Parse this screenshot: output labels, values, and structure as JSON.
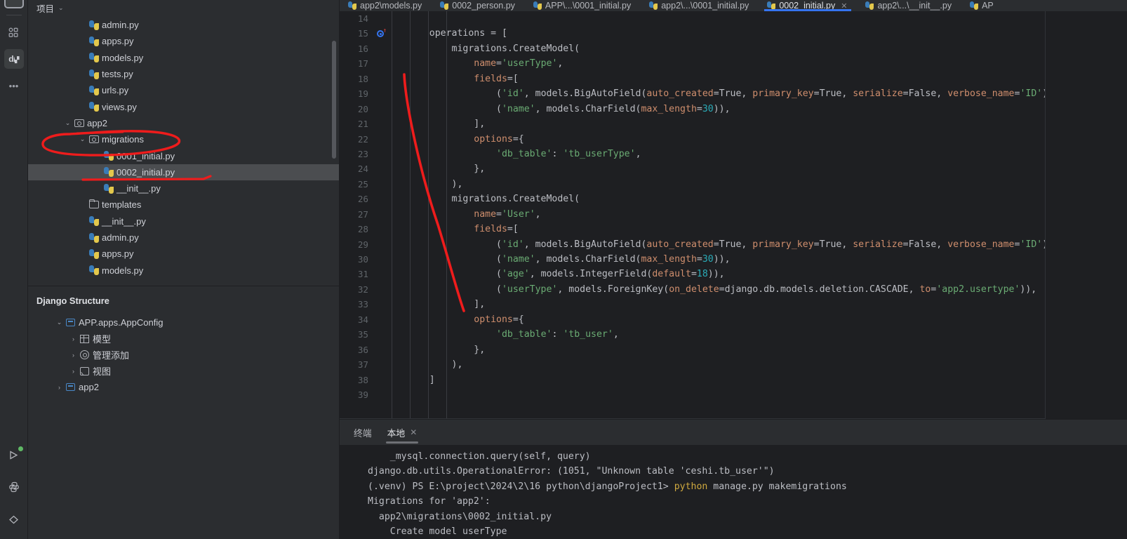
{
  "activitybar": {
    "items": [
      {
        "name": "project-tool-window-icon",
        "glyph": "▭"
      },
      {
        "name": "structure-tool-window-icon",
        "glyph": "▫▫"
      },
      {
        "name": "database-tool-window-icon",
        "glyph": "di"
      },
      {
        "name": "more-tool-windows-icon",
        "glyph": "•••"
      }
    ],
    "bottom_items": [
      {
        "name": "run-icon",
        "glyph": "▷"
      },
      {
        "name": "python-console-icon",
        "glyph": "py"
      },
      {
        "name": "problems-icon",
        "glyph": "◇"
      }
    ]
  },
  "project_panel": {
    "title": "项目",
    "tree": [
      {
        "indent": 3,
        "twisty": "",
        "icon": "py",
        "label": "admin.py"
      },
      {
        "indent": 3,
        "twisty": "",
        "icon": "py",
        "label": "apps.py"
      },
      {
        "indent": 3,
        "twisty": "",
        "icon": "py",
        "label": "models.py"
      },
      {
        "indent": 3,
        "twisty": "",
        "icon": "py",
        "label": "tests.py"
      },
      {
        "indent": 3,
        "twisty": "",
        "icon": "py",
        "label": "urls.py"
      },
      {
        "indent": 3,
        "twisty": "",
        "icon": "py",
        "label": "views.py"
      },
      {
        "indent": 2,
        "twisty": "⌄",
        "icon": "folder-mod",
        "label": "app2"
      },
      {
        "indent": 3,
        "twisty": "⌄",
        "icon": "folder-mod",
        "label": "migrations"
      },
      {
        "indent": 4,
        "twisty": "",
        "icon": "py",
        "label": "0001_initial.py"
      },
      {
        "indent": 4,
        "twisty": "",
        "icon": "py",
        "label": "0002_initial.py",
        "selected": true
      },
      {
        "indent": 4,
        "twisty": "",
        "icon": "py",
        "label": "__init__.py"
      },
      {
        "indent": 3,
        "twisty": "",
        "icon": "folder",
        "label": "templates"
      },
      {
        "indent": 3,
        "twisty": "",
        "icon": "py",
        "label": "__init__.py"
      },
      {
        "indent": 3,
        "twisty": "",
        "icon": "py",
        "label": "admin.py"
      },
      {
        "indent": 3,
        "twisty": "",
        "icon": "py",
        "label": "apps.py"
      },
      {
        "indent": 3,
        "twisty": "",
        "icon": "py",
        "label": "models.py"
      }
    ]
  },
  "structure_panel": {
    "title": "Django Structure",
    "rows": [
      {
        "indent": 1,
        "twisty": "⌄",
        "icon": "square",
        "label": "APP.apps.AppConfig"
      },
      {
        "indent": 2,
        "twisty": "›",
        "icon": "grid",
        "label": "模型"
      },
      {
        "indent": 2,
        "twisty": "›",
        "icon": "gear",
        "label": "管理添加"
      },
      {
        "indent": 2,
        "twisty": "›",
        "icon": "image",
        "label": "视图"
      },
      {
        "indent": 1,
        "twisty": "›",
        "icon": "square",
        "label": "app2"
      }
    ]
  },
  "editor": {
    "tabs": [
      {
        "label": "app2\\models.py",
        "active": false,
        "closable": false
      },
      {
        "label": "0002_person.py",
        "active": false,
        "closable": false
      },
      {
        "label": "APP\\...\\0001_initial.py",
        "active": false,
        "closable": false
      },
      {
        "label": "app2\\...\\0001_initial.py",
        "active": false,
        "closable": false
      },
      {
        "label": "0002_initial.py",
        "active": true,
        "closable": true,
        "close_glyph": "✕"
      },
      {
        "label": "app2\\...\\__init__.py",
        "active": false,
        "closable": false
      },
      {
        "label": "AP",
        "active": false,
        "closable": false
      }
    ],
    "first_line_number": 14,
    "lines": [
      {
        "num": 14,
        "marker": false,
        "tokens": []
      },
      {
        "num": 15,
        "marker": true,
        "tokens": [
          {
            "t": "    ",
            "c": "t-def"
          },
          {
            "t": "operations",
            "c": "t-def"
          },
          {
            "t": " = [",
            "c": "t-def"
          }
        ]
      },
      {
        "num": 16,
        "marker": false,
        "tokens": [
          {
            "t": "        migrations.CreateModel(",
            "c": "t-def"
          }
        ]
      },
      {
        "num": 17,
        "marker": false,
        "tokens": [
          {
            "t": "            ",
            "c": "t-def"
          },
          {
            "t": "name",
            "c": "t-kw"
          },
          {
            "t": "=",
            "c": "t-def"
          },
          {
            "t": "'userType'",
            "c": "t-str"
          },
          {
            "t": ",",
            "c": "t-def"
          }
        ]
      },
      {
        "num": 18,
        "marker": false,
        "tokens": [
          {
            "t": "            ",
            "c": "t-def"
          },
          {
            "t": "fields",
            "c": "t-kw"
          },
          {
            "t": "=[",
            "c": "t-def"
          }
        ]
      },
      {
        "num": 19,
        "marker": false,
        "tokens": [
          {
            "t": "                (",
            "c": "t-def"
          },
          {
            "t": "'id'",
            "c": "t-str"
          },
          {
            "t": ", models.BigAutoField(",
            "c": "t-def"
          },
          {
            "t": "auto_created",
            "c": "t-kw"
          },
          {
            "t": "=True, ",
            "c": "t-def"
          },
          {
            "t": "primary_key",
            "c": "t-kw"
          },
          {
            "t": "=True, ",
            "c": "t-def"
          },
          {
            "t": "serialize",
            "c": "t-kw"
          },
          {
            "t": "=False, ",
            "c": "t-def"
          },
          {
            "t": "verbose_name",
            "c": "t-kw"
          },
          {
            "t": "=",
            "c": "t-def"
          },
          {
            "t": "'ID'",
            "c": "t-str"
          },
          {
            "t": ")),",
            "c": "t-def"
          }
        ]
      },
      {
        "num": 20,
        "marker": false,
        "tokens": [
          {
            "t": "                (",
            "c": "t-def"
          },
          {
            "t": "'name'",
            "c": "t-str"
          },
          {
            "t": ", models.CharField(",
            "c": "t-def"
          },
          {
            "t": "max_length",
            "c": "t-kw"
          },
          {
            "t": "=",
            "c": "t-def"
          },
          {
            "t": "30",
            "c": "t-num"
          },
          {
            "t": ")),",
            "c": "t-def"
          }
        ]
      },
      {
        "num": 21,
        "marker": false,
        "tokens": [
          {
            "t": "            ],",
            "c": "t-def"
          }
        ]
      },
      {
        "num": 22,
        "marker": false,
        "tokens": [
          {
            "t": "            ",
            "c": "t-def"
          },
          {
            "t": "options",
            "c": "t-kw"
          },
          {
            "t": "={",
            "c": "t-def"
          }
        ]
      },
      {
        "num": 23,
        "marker": false,
        "tokens": [
          {
            "t": "                ",
            "c": "t-def"
          },
          {
            "t": "'db_table'",
            "c": "t-str"
          },
          {
            "t": ": ",
            "c": "t-def"
          },
          {
            "t": "'tb_userType'",
            "c": "t-str"
          },
          {
            "t": ",",
            "c": "t-def"
          }
        ]
      },
      {
        "num": 24,
        "marker": false,
        "tokens": [
          {
            "t": "            },",
            "c": "t-def"
          }
        ]
      },
      {
        "num": 25,
        "marker": false,
        "tokens": [
          {
            "t": "        ),",
            "c": "t-def"
          }
        ]
      },
      {
        "num": 26,
        "marker": false,
        "tokens": [
          {
            "t": "        migrations.CreateModel(",
            "c": "t-def"
          }
        ]
      },
      {
        "num": 27,
        "marker": false,
        "tokens": [
          {
            "t": "            ",
            "c": "t-def"
          },
          {
            "t": "name",
            "c": "t-kw"
          },
          {
            "t": "=",
            "c": "t-def"
          },
          {
            "t": "'User'",
            "c": "t-str"
          },
          {
            "t": ",",
            "c": "t-def"
          }
        ]
      },
      {
        "num": 28,
        "marker": false,
        "tokens": [
          {
            "t": "            ",
            "c": "t-def"
          },
          {
            "t": "fields",
            "c": "t-kw"
          },
          {
            "t": "=[",
            "c": "t-def"
          }
        ]
      },
      {
        "num": 29,
        "marker": false,
        "tokens": [
          {
            "t": "                (",
            "c": "t-def"
          },
          {
            "t": "'id'",
            "c": "t-str"
          },
          {
            "t": ", models.BigAutoField(",
            "c": "t-def"
          },
          {
            "t": "auto_created",
            "c": "t-kw"
          },
          {
            "t": "=True, ",
            "c": "t-def"
          },
          {
            "t": "primary_key",
            "c": "t-kw"
          },
          {
            "t": "=True, ",
            "c": "t-def"
          },
          {
            "t": "serialize",
            "c": "t-kw"
          },
          {
            "t": "=False, ",
            "c": "t-def"
          },
          {
            "t": "verbose_name",
            "c": "t-kw"
          },
          {
            "t": "=",
            "c": "t-def"
          },
          {
            "t": "'ID'",
            "c": "t-str"
          },
          {
            "t": ")),",
            "c": "t-def"
          }
        ]
      },
      {
        "num": 30,
        "marker": false,
        "tokens": [
          {
            "t": "                (",
            "c": "t-def"
          },
          {
            "t": "'name'",
            "c": "t-str"
          },
          {
            "t": ", models.CharField(",
            "c": "t-def"
          },
          {
            "t": "max_length",
            "c": "t-kw"
          },
          {
            "t": "=",
            "c": "t-def"
          },
          {
            "t": "30",
            "c": "t-num"
          },
          {
            "t": ")),",
            "c": "t-def"
          }
        ]
      },
      {
        "num": 31,
        "marker": false,
        "tokens": [
          {
            "t": "                (",
            "c": "t-def"
          },
          {
            "t": "'age'",
            "c": "t-str"
          },
          {
            "t": ", models.IntegerField(",
            "c": "t-def"
          },
          {
            "t": "default",
            "c": "t-kw"
          },
          {
            "t": "=",
            "c": "t-def"
          },
          {
            "t": "18",
            "c": "t-num"
          },
          {
            "t": ")),",
            "c": "t-def"
          }
        ]
      },
      {
        "num": 32,
        "marker": false,
        "tokens": [
          {
            "t": "                (",
            "c": "t-def"
          },
          {
            "t": "'userType'",
            "c": "t-str"
          },
          {
            "t": ", models.ForeignKey(",
            "c": "t-def"
          },
          {
            "t": "on_delete",
            "c": "t-kw"
          },
          {
            "t": "=django.db.models.deletion.CASCADE, ",
            "c": "t-def"
          },
          {
            "t": "to",
            "c": "t-kw"
          },
          {
            "t": "=",
            "c": "t-def"
          },
          {
            "t": "'app2.usertype'",
            "c": "t-str"
          },
          {
            "t": ")),",
            "c": "t-def"
          }
        ]
      },
      {
        "num": 33,
        "marker": false,
        "tokens": [
          {
            "t": "            ],",
            "c": "t-def"
          }
        ]
      },
      {
        "num": 34,
        "marker": false,
        "tokens": [
          {
            "t": "            ",
            "c": "t-def"
          },
          {
            "t": "options",
            "c": "t-kw"
          },
          {
            "t": "={",
            "c": "t-def"
          }
        ]
      },
      {
        "num": 35,
        "marker": false,
        "tokens": [
          {
            "t": "                ",
            "c": "t-def"
          },
          {
            "t": "'db_table'",
            "c": "t-str"
          },
          {
            "t": ": ",
            "c": "t-def"
          },
          {
            "t": "'tb_user'",
            "c": "t-str"
          },
          {
            "t": ",",
            "c": "t-def"
          }
        ]
      },
      {
        "num": 36,
        "marker": false,
        "tokens": [
          {
            "t": "            },",
            "c": "t-def"
          }
        ]
      },
      {
        "num": 37,
        "marker": false,
        "tokens": [
          {
            "t": "        ),",
            "c": "t-def"
          }
        ]
      },
      {
        "num": 38,
        "marker": false,
        "tokens": [
          {
            "t": "    ]",
            "c": "t-def"
          }
        ]
      },
      {
        "num": 39,
        "marker": false,
        "tokens": []
      }
    ]
  },
  "terminal": {
    "tabs": [
      {
        "label": "终端",
        "active": false,
        "closable": false
      },
      {
        "label": "本地",
        "active": true,
        "closable": true,
        "close_glyph": "✕"
      }
    ],
    "lines": [
      [
        {
          "t": "    _mysql.connection.query(self, query)",
          "c": ""
        }
      ],
      [
        {
          "t": "django.db.utils.OperationalError: (1051, \"Unknown table 'ceshi.tb_user'\")",
          "c": ""
        }
      ],
      [
        {
          "t": "(.venv) PS E:\\project\\2024\\2\\16 python\\djangoProject1> ",
          "c": ""
        },
        {
          "t": "python",
          "c": "term-yellow"
        },
        {
          "t": " manage.py makemigrations",
          "c": ""
        }
      ],
      [
        {
          "t": "Migrations for 'app2':",
          "c": ""
        }
      ],
      [
        {
          "t": "  app2\\migrations\\0002_initial.py",
          "c": ""
        }
      ],
      [
        {
          "t": "    Create model userType",
          "c": ""
        }
      ]
    ]
  },
  "annotations": {
    "color": "#ee1c1c",
    "shapes": [
      "ellipse-around-migrations",
      "underline-0002-initial",
      "curve-in-editor"
    ]
  }
}
